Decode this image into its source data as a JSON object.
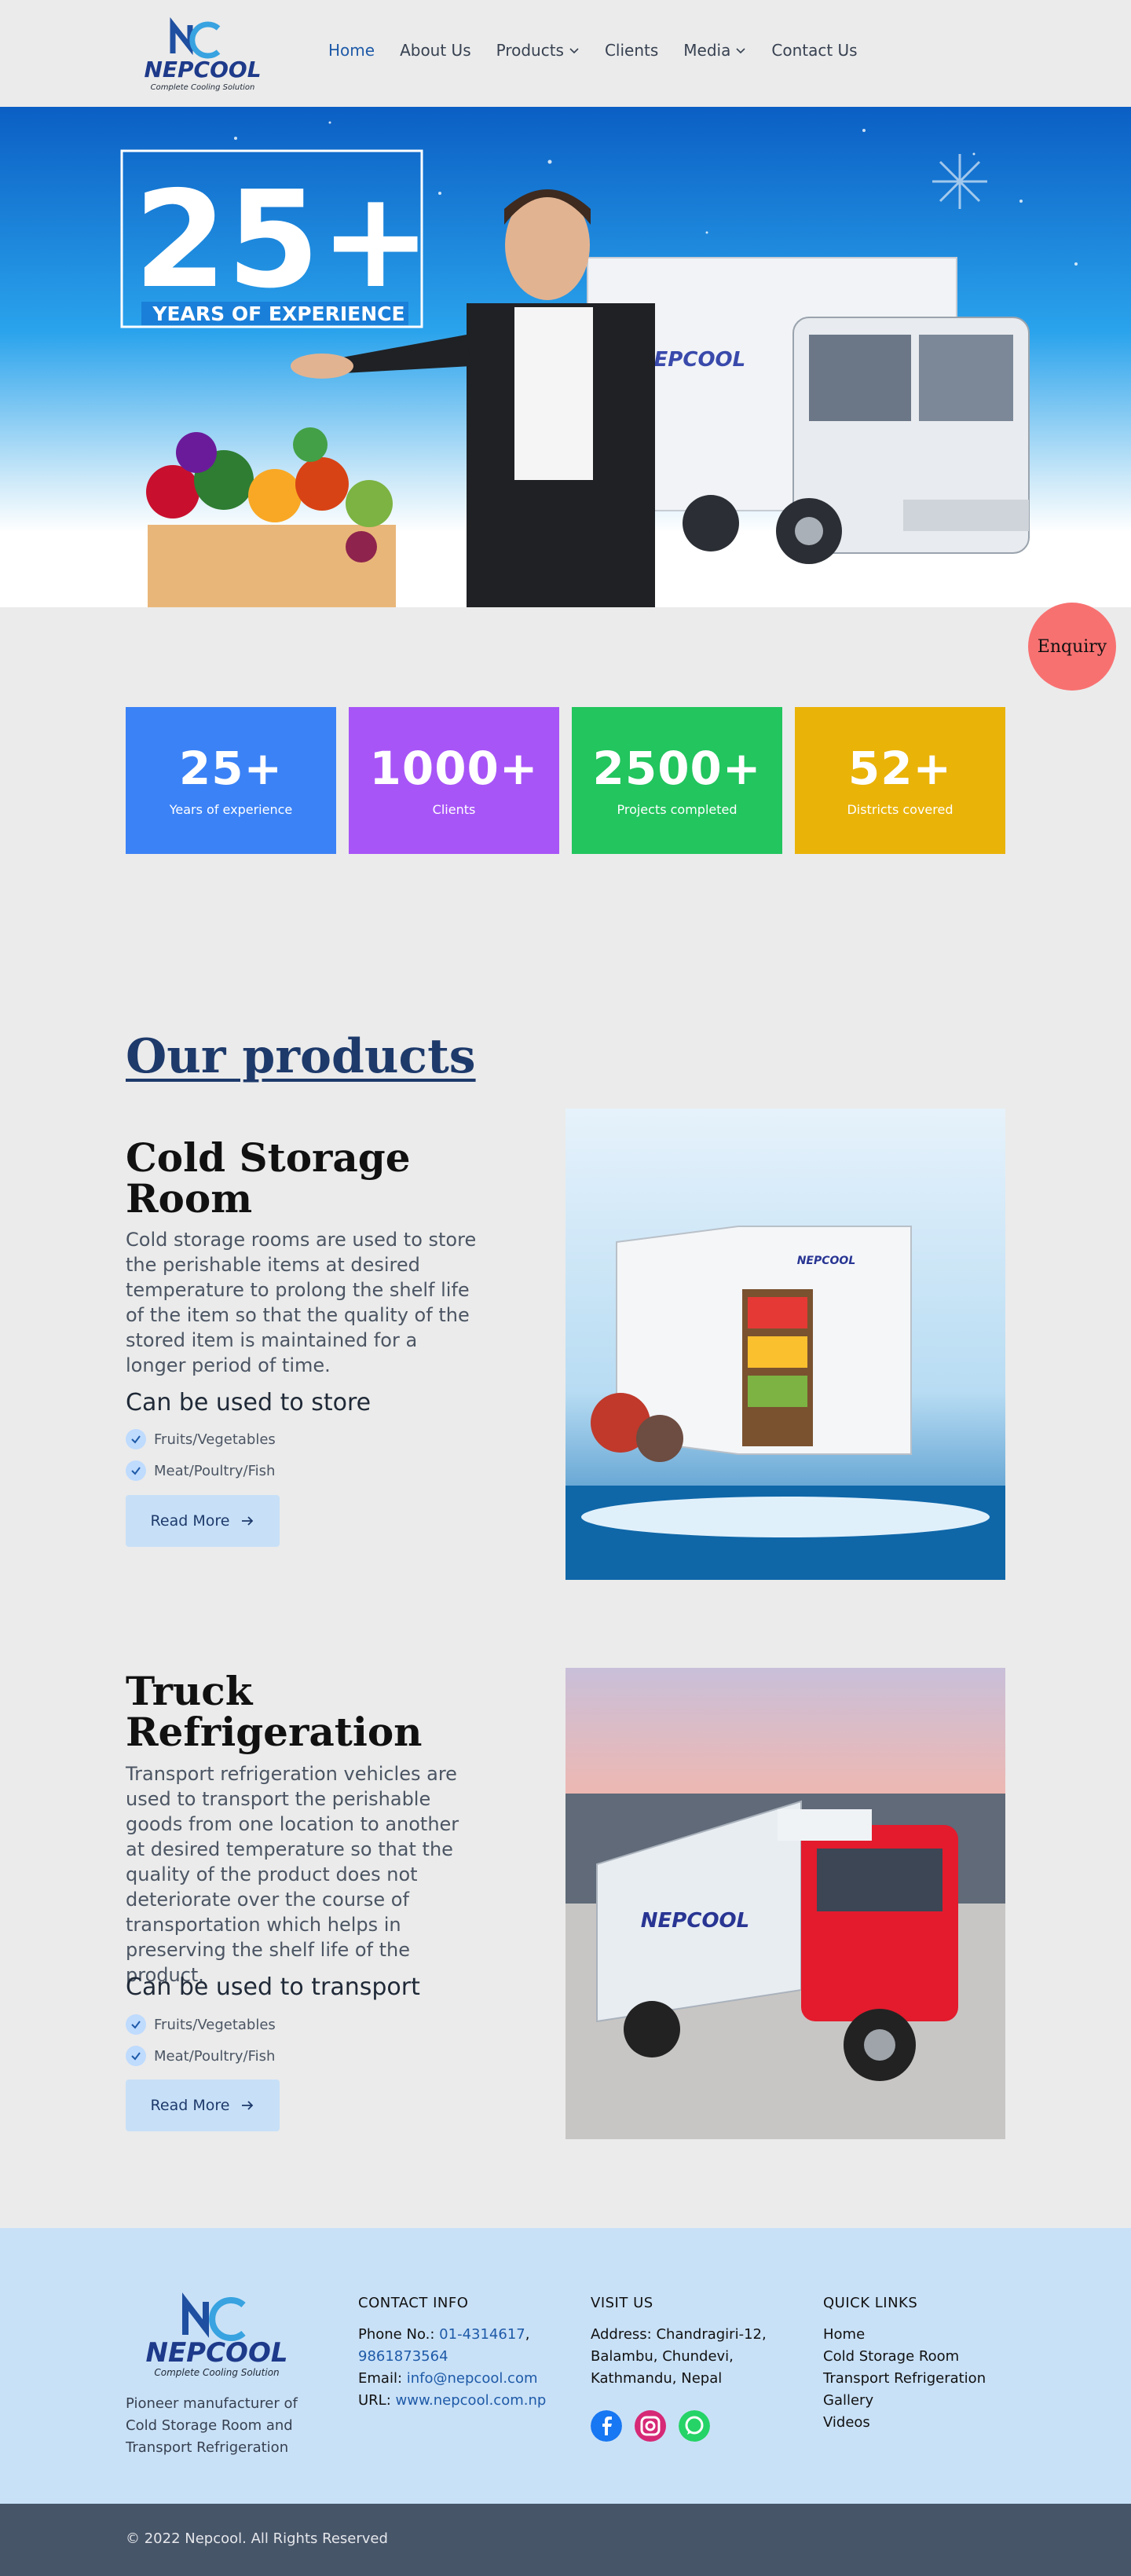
{
  "brand": {
    "name": "NEPCOOL",
    "tagline": "Complete Cooling Solution"
  },
  "nav": {
    "items": [
      {
        "label": "Home",
        "active": true,
        "dropdown": false
      },
      {
        "label": "About Us",
        "active": false,
        "dropdown": false
      },
      {
        "label": "Products",
        "active": false,
        "dropdown": true
      },
      {
        "label": "Clients",
        "active": false,
        "dropdown": false
      },
      {
        "label": "Media",
        "active": false,
        "dropdown": true
      },
      {
        "label": "Contact Us",
        "active": false,
        "dropdown": false
      }
    ]
  },
  "hero": {
    "big": "25+",
    "caption": "YEARS OF EXPERIENCE"
  },
  "enquiry_label": "Enquiry",
  "stats": [
    {
      "value": "25+",
      "label": "Years of experience",
      "color": "#3b82f6"
    },
    {
      "value": "1000+",
      "label": "Clients",
      "color": "#a855f7"
    },
    {
      "value": "2500+",
      "label": "Projects completed",
      "color": "#22c55e"
    },
    {
      "value": "52+",
      "label": "Districts covered",
      "color": "#eab308"
    }
  ],
  "products": {
    "heading": "Our products",
    "items": [
      {
        "title": "Cold Storage Room",
        "description": "Cold storage rooms are used to store the perishable items at desired temperature to prolong the shelf life of the item so that the quality of the stored item is maintained for a longer period of time.",
        "use_heading": "Can be used to store",
        "uses": [
          "Fruits/Vegetables",
          "Meat/Poultry/Fish"
        ],
        "button": "Read More"
      },
      {
        "title": "Truck Refrigeration",
        "description": "Transport refrigeration vehicles are used to transport the perishable goods from one location to another at desired temperature so that the quality of the product does not deteriorate over the course of transportation which helps in preserving the shelf life of the product.",
        "use_heading": "Can be used to transport",
        "uses": [
          "Fruits/Vegetables",
          "Meat/Poultry/Fish"
        ],
        "button": "Read More"
      }
    ]
  },
  "footer": {
    "tagline": "Pioneer manufacturer of Cold Storage Room and Transport Refrigeration",
    "contact": {
      "heading": "CONTACT INFO",
      "phone_label": "Phone No.:",
      "phone1": "01-4314617",
      "phone2": "9861873564",
      "email_label": "Email:",
      "email": "info@nepcool.com",
      "url_label": "URL:",
      "url": "www.nepcool.com.np"
    },
    "visit": {
      "heading": "VISIT US",
      "address_label": "Address:",
      "address": "Chandragiri-12, Balambu, Chundevi, Kathmandu, Nepal"
    },
    "socials": [
      "facebook-icon",
      "instagram-icon",
      "whatsapp-icon"
    ],
    "quick_links": {
      "heading": "QUICK LINKS",
      "items": [
        "Home",
        "Cold Storage Room",
        "Transport Refrigeration",
        "Gallery",
        "Videos"
      ]
    },
    "copyright": "© 2022 Nepcool. All Rights Reserved"
  },
  "colors": {
    "primary": "#1e5aa8",
    "dark_blue": "#1e3a6b",
    "footer_bg": "#c9e1f7",
    "bottom_bar": "#475569",
    "enquiry": "#f87171"
  }
}
